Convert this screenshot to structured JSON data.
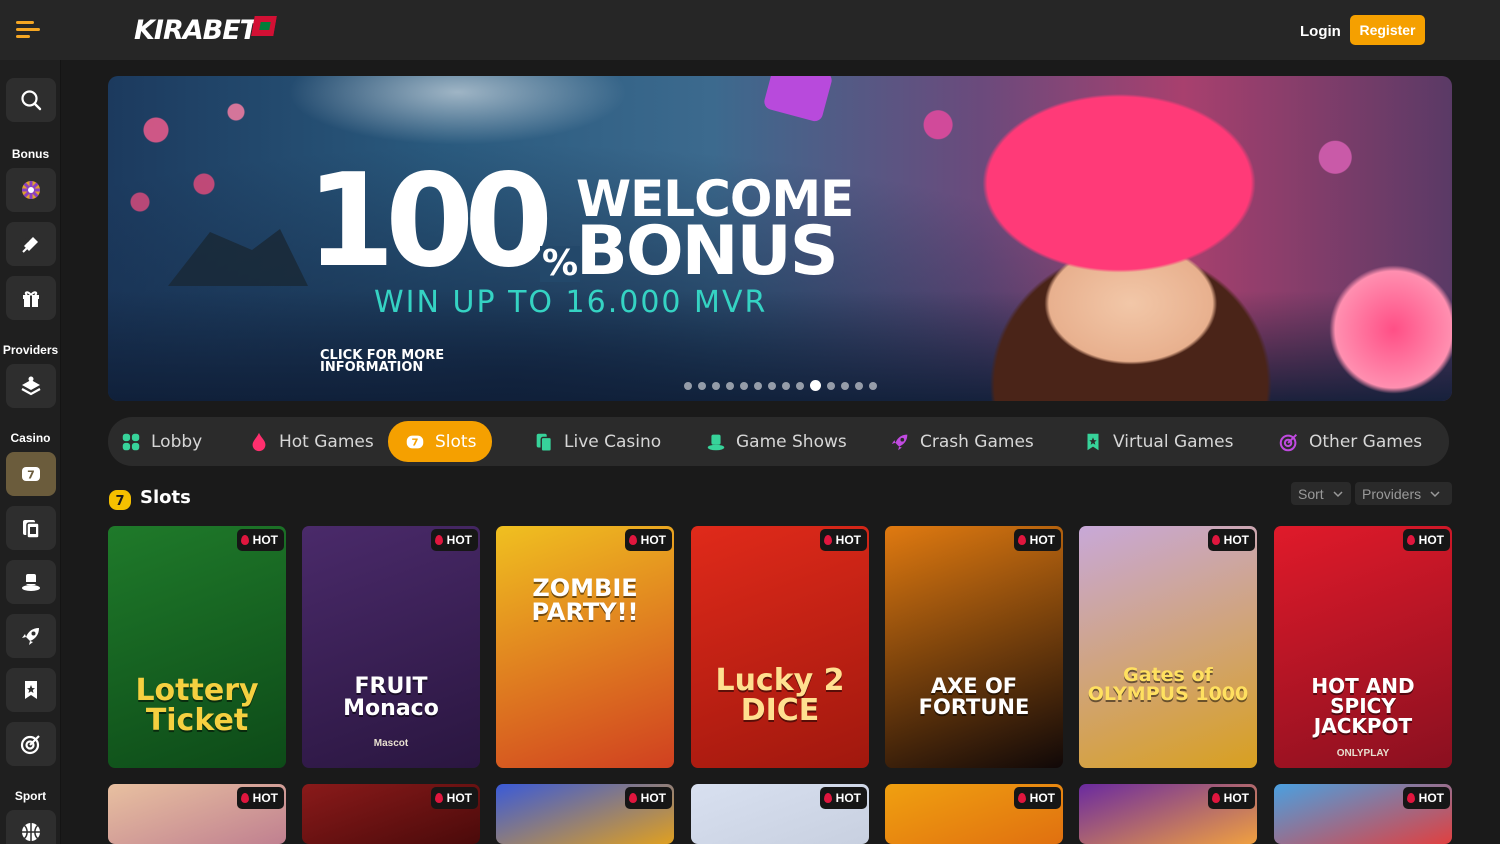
{
  "header": {
    "logo_text": "KIRABET",
    "login_label": "Login",
    "register_label": "Register"
  },
  "sidebar": {
    "sections": {
      "bonus": "Bonus",
      "providers": "Providers",
      "casino": "Casino",
      "sport": "Sport"
    }
  },
  "banner": {
    "big_number": "100",
    "percent": "%",
    "line1": "WELCOME",
    "line2": "BONUS",
    "subline": "WIN UP TO 16.000 MVR",
    "cta": [
      "CLICK FOR MORE",
      "INFORMATION"
    ],
    "slides_total": 14,
    "active_slide": 10
  },
  "categories": [
    {
      "label": "Lobby",
      "icon": "grid-icon",
      "color": "#37d39a"
    },
    {
      "label": "Hot Games",
      "icon": "flame-icon",
      "color": "#ff2f6e"
    },
    {
      "label": "Slots",
      "icon": "slot-icon",
      "color": "#ffffff"
    },
    {
      "label": "Live Casino",
      "icon": "live-cards-icon",
      "color": "#37d39a"
    },
    {
      "label": "Game Shows",
      "icon": "top-hat-icon",
      "color": "#37d39a"
    },
    {
      "label": "Crash Games",
      "icon": "rocket-icon",
      "color": "#c04ae0"
    },
    {
      "label": "Virtual Games",
      "icon": "bookmark-star-icon",
      "color": "#37d39a"
    },
    {
      "label": "Other Games",
      "icon": "target-icon",
      "color": "#c04ae0"
    }
  ],
  "active_category": "Slots",
  "section": {
    "title": "Slots",
    "sort_label": "Sort",
    "providers_label": "Providers"
  },
  "badge_label": "HOT",
  "games": [
    {
      "title": "Lottery Ticket",
      "colors": [
        "#1f7a2a",
        "#0d4a18"
      ]
    },
    {
      "title": "FRUIT Monaco",
      "subtitle": "Mascot",
      "colors": [
        "#4a2a6a",
        "#2a1640"
      ]
    },
    {
      "title": "ZOMBIE PARTY!!",
      "colors": [
        "#f0c020",
        "#d04020"
      ]
    },
    {
      "title": "Lucky 2 DICE",
      "colors": [
        "#e02a1a",
        "#a0180e"
      ]
    },
    {
      "title": "AXE OF FORTUNE",
      "colors": [
        "#e07a10",
        "#100808"
      ]
    },
    {
      "title": "Gates of OLYMPUS 1000",
      "colors": [
        "#c8a8d8",
        "#d8a020"
      ]
    },
    {
      "title": "HOT AND SPICY JACKPOT",
      "subtitle": "ONLYPLAY",
      "colors": [
        "#e01a2a",
        "#8a1020"
      ]
    }
  ],
  "games_row2": [
    {
      "colors": [
        "#e8c0a0",
        "#c08090"
      ]
    },
    {
      "colors": [
        "#8a1a1a",
        "#4a0a0a"
      ]
    },
    {
      "colors": [
        "#3a5ad8",
        "#e0a020"
      ]
    },
    {
      "colors": [
        "#d8e0f0",
        "#c8d0e0"
      ]
    },
    {
      "colors": [
        "#f0a010",
        "#e07010"
      ]
    },
    {
      "colors": [
        "#6a2aa0",
        "#f0a040"
      ]
    },
    {
      "colors": [
        "#4aa0e0",
        "#e04040"
      ]
    }
  ]
}
